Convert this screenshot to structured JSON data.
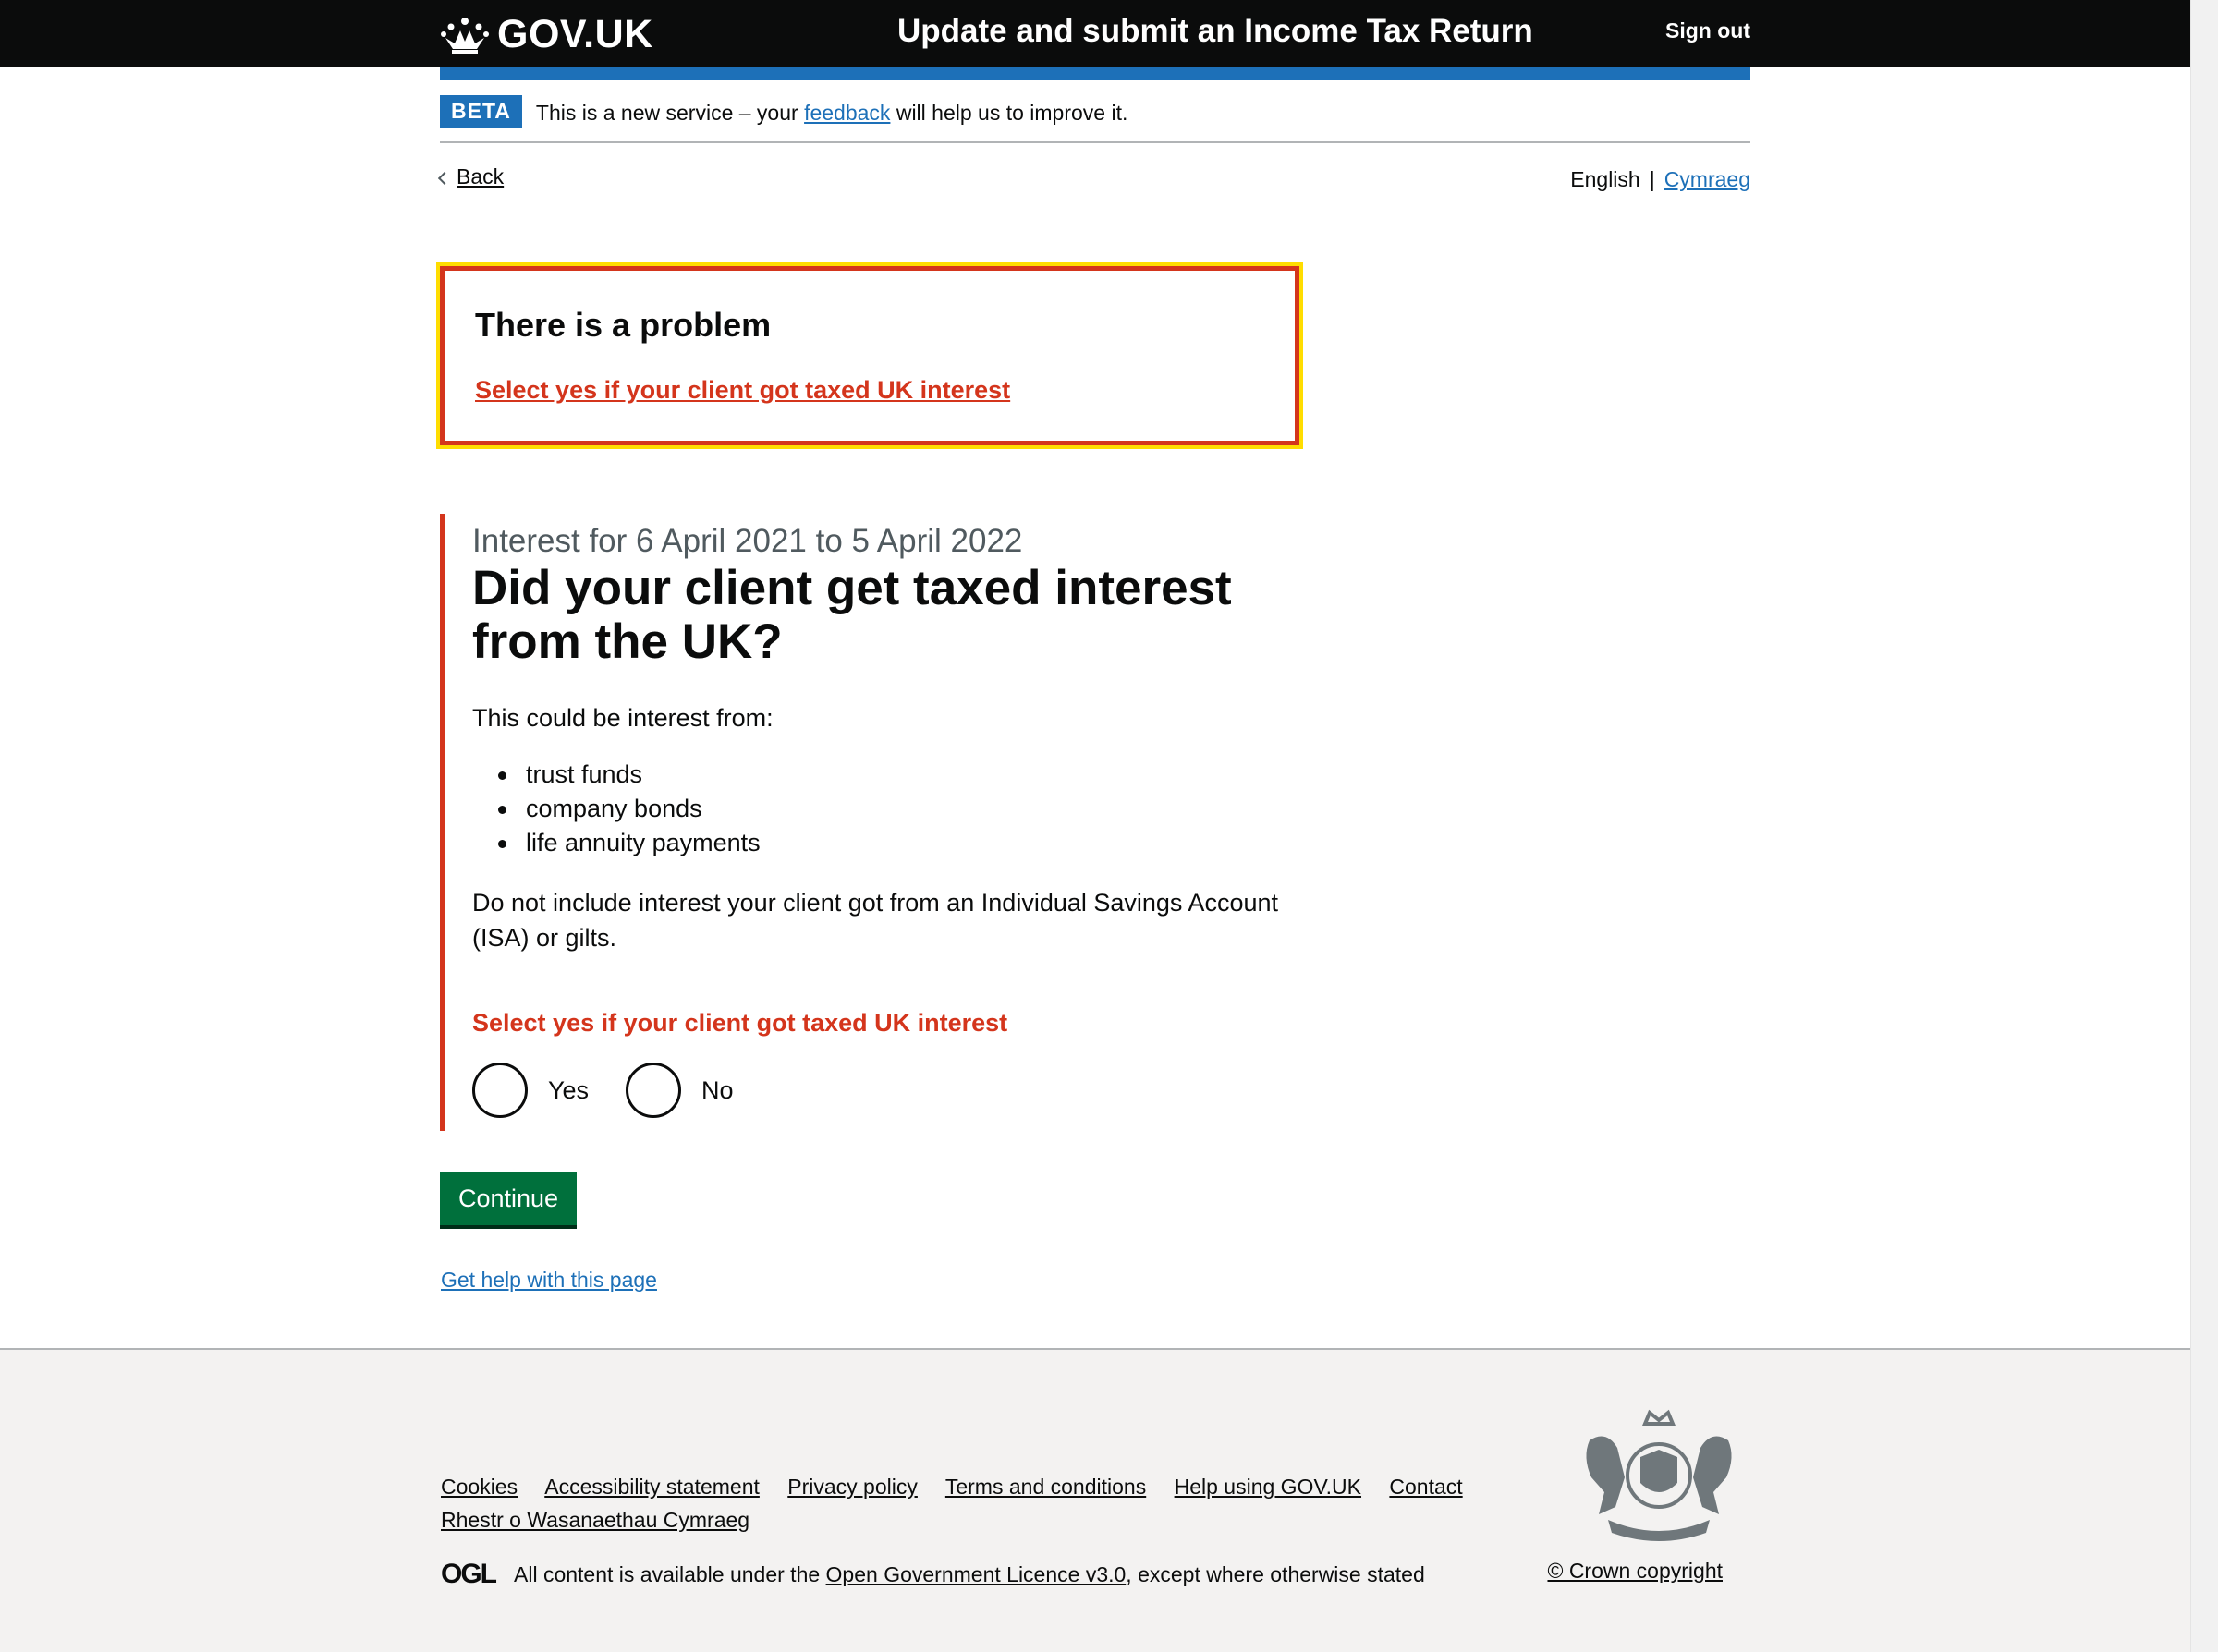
{
  "header": {
    "logo_text": "GOV.UK",
    "service_name": "Update and submit an Income Tax Return",
    "sign_out": "Sign out"
  },
  "phase_banner": {
    "tag": "BETA",
    "text_before": "This is a new service – your ",
    "link": "feedback",
    "text_after": " will help us to improve it."
  },
  "nav": {
    "back": "Back",
    "lang_english": "English",
    "lang_separator": "|",
    "lang_welsh": "Cymraeg"
  },
  "error_summary": {
    "title": "There is a problem",
    "link": "Select yes if your client got taxed UK interest"
  },
  "question": {
    "caption": "Interest for 6 April 2021 to 5 April 2022",
    "heading": "Did your client get taxed interest from the UK?",
    "intro": "This could be interest from:",
    "bullets": [
      "trust funds",
      "company bonds",
      "life annuity payments"
    ],
    "exclude": "Do not include interest your client got from an Individual Savings Account (ISA) or gilts.",
    "error_message": "Select yes if your client got taxed UK interest",
    "options": [
      "Yes",
      "No"
    ]
  },
  "actions": {
    "continue": "Continue",
    "help": "Get help with this page"
  },
  "footer": {
    "links": [
      "Cookies",
      "Accessibility statement",
      "Privacy policy",
      "Terms and conditions",
      "Help using GOV.UK",
      "Contact",
      "Rhestr o Wasanaethau Cymraeg"
    ],
    "ogl_logo": "OGL",
    "licence_before": "All content is available under the ",
    "licence_link": "Open Government Licence v3.0",
    "licence_after": ", except where otherwise stated",
    "copyright": "© Crown copyright"
  },
  "colors": {
    "header_bg": "#0b0c0c",
    "brand_blue": "#1d70b8",
    "error_red": "#d4351c",
    "focus_yellow": "#ffdd00",
    "button_green": "#00703c"
  }
}
